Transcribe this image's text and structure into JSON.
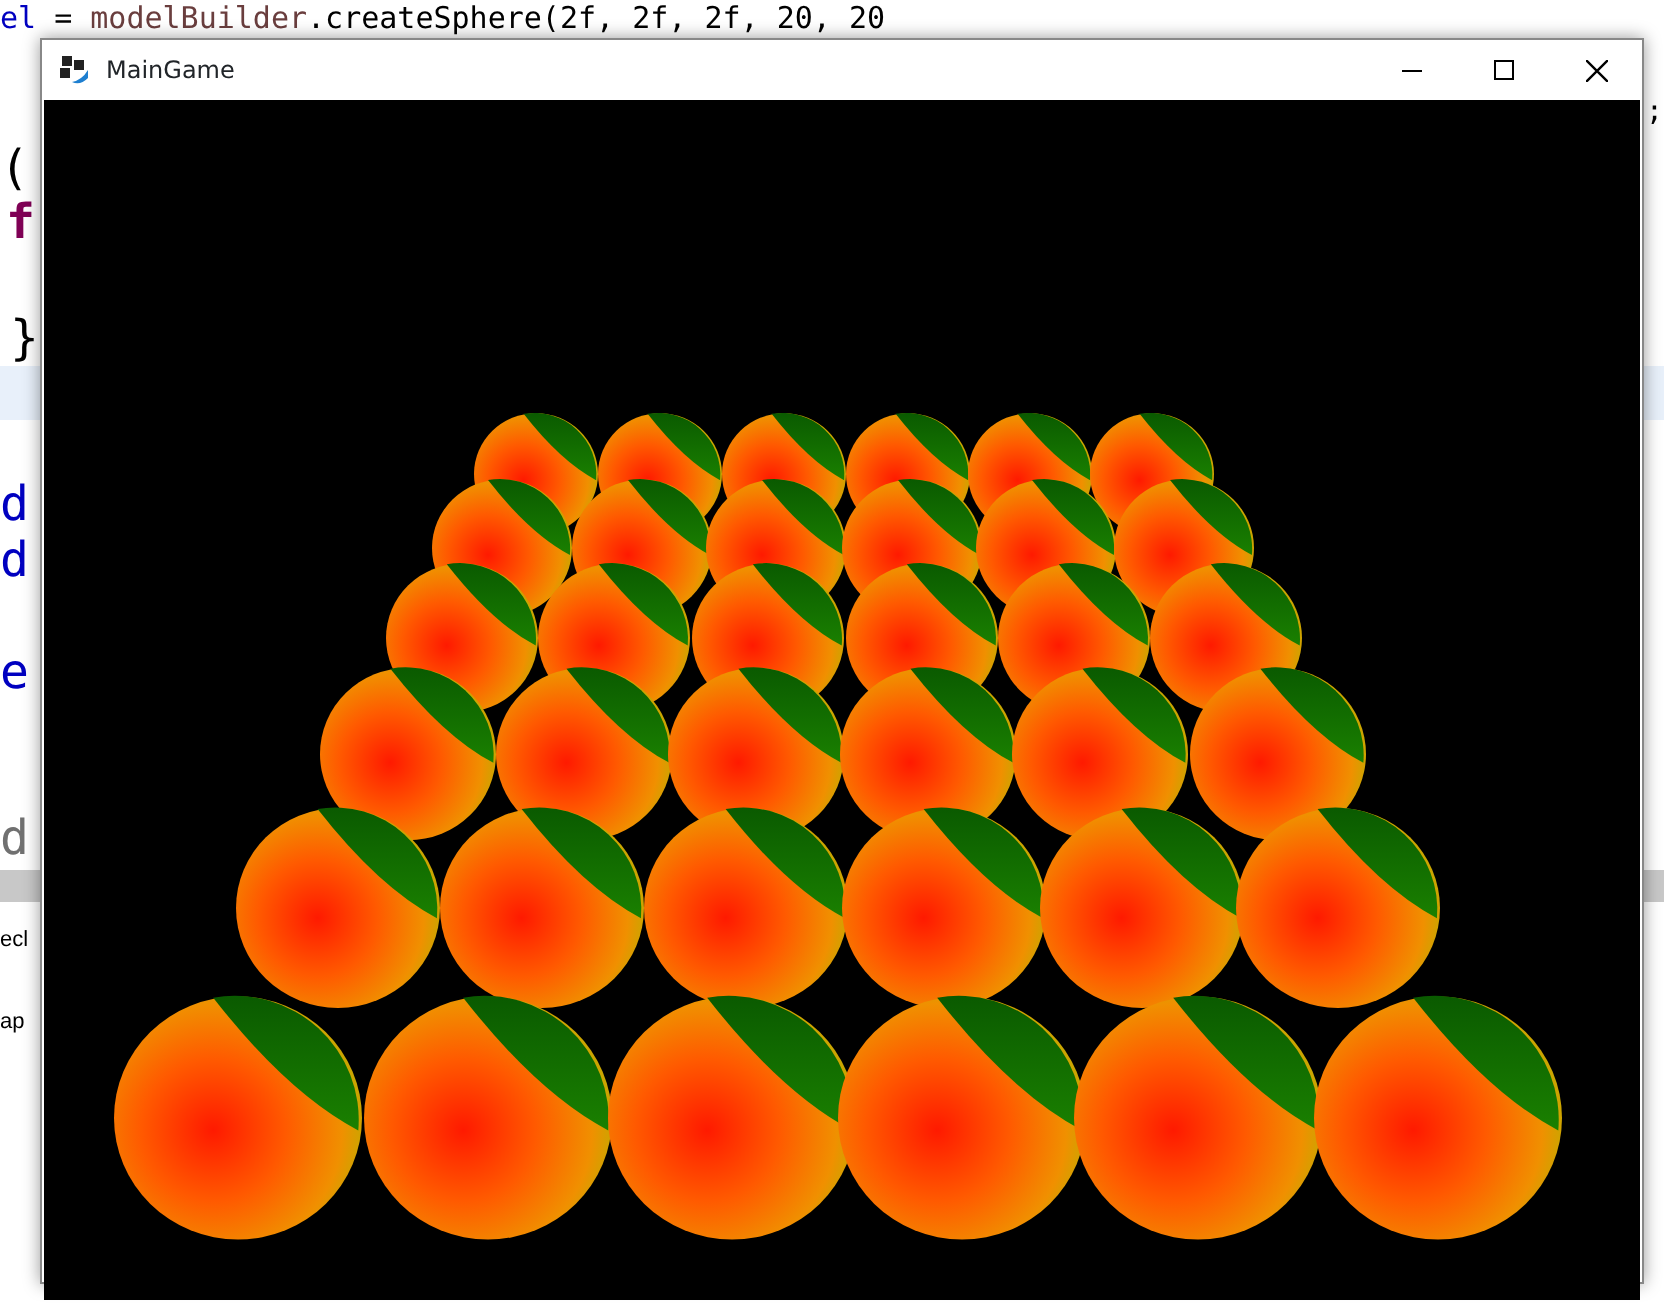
{
  "editor": {
    "lines": [
      {
        "tokens": [
          {
            "text": "el",
            "kind": "field"
          },
          {
            "text": " = ",
            "kind": "plain"
          },
          {
            "text": "modelBuilder",
            "kind": "variable"
          },
          {
            "text": ".createSphere(2f, 2f, 2f, 20, 20",
            "kind": "plain"
          }
        ]
      },
      {
        "tokens": [
          {
            "text": ";",
            "kind": "plain"
          }
        ]
      },
      {
        "tokens": [
          {
            "text": "(",
            "kind": "plain"
          }
        ]
      },
      {
        "tokens": [
          {
            "text": "f",
            "kind": "keyword"
          }
        ]
      },
      {
        "tokens": [
          {
            "text": "}",
            "kind": "plain"
          }
        ]
      },
      {
        "tokens": [
          {
            "text": "d",
            "kind": "field"
          }
        ]
      },
      {
        "tokens": [
          {
            "text": "d",
            "kind": "field"
          }
        ]
      },
      {
        "tokens": [
          {
            "text": "e",
            "kind": "field"
          }
        ]
      },
      {
        "tokens": [
          {
            "text": "d",
            "kind": "muted"
          }
        ]
      }
    ]
  },
  "panel": {
    "tabs": [
      {
        "label": "ecl"
      },
      {
        "label": "ap"
      }
    ]
  },
  "window": {
    "title": "MainGame"
  }
}
